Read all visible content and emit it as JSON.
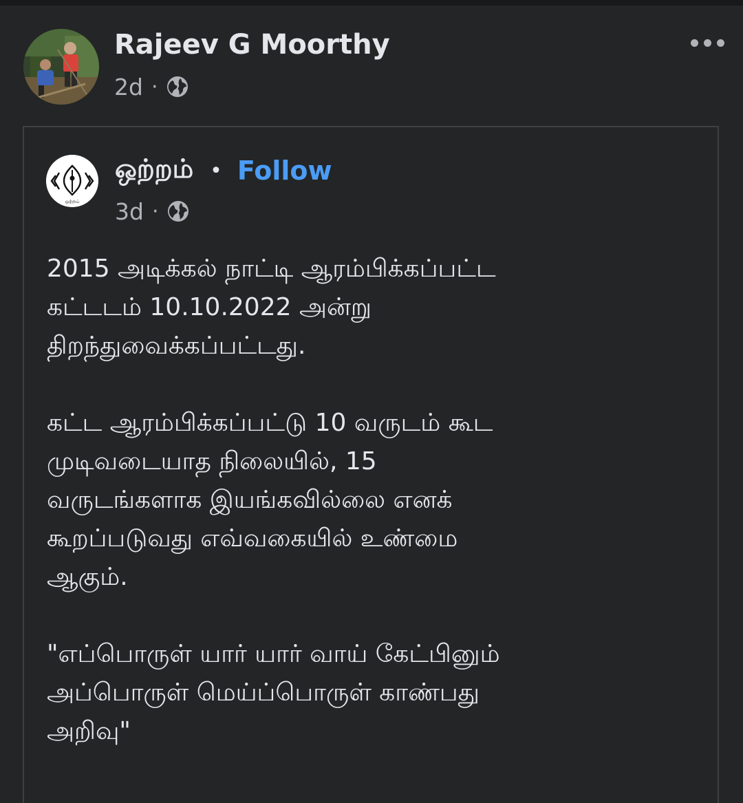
{
  "post": {
    "author": "Rajeev G Moorthy",
    "time": "2d",
    "separator": "·",
    "audience_icon": "globe-icon",
    "more_icon": "more-horizontal-icon"
  },
  "shared_post": {
    "page_name": "ஒற்றம்",
    "separator": "•",
    "follow_label": "Follow",
    "time": "3d",
    "meta_separator": "·",
    "audience_icon": "globe-icon",
    "logo_text": "ஒற்றம்",
    "body": [
      [
        "2015 அடிக்கல் நாட்டி ஆரம்பிக்கப்பட்ட",
        "கட்டடம்  10.10.2022 அன்று",
        "திறந்துவைக்கப்பட்டது."
      ],
      [
        "கட்ட ஆரம்பிக்கப்பட்டு 10 வருடம் கூட",
        "முடிவடையாத நிலையில், 15",
        "வருடங்களாக இயங்கவில்லை எனக்",
        "கூறப்படுவது எவ்வகையில் உண்மை",
        "ஆகும்."
      ],
      [
        "\"எப்பொருள் யார் யார் வாய் கேட்பினும்",
        "அப்பொருள் மெய்ப்பொருள் காண்பது",
        "அறிவு\""
      ]
    ]
  },
  "colors": {
    "background": "#242526",
    "primary_text": "#e4e6eb",
    "secondary_text": "#b0b3b8",
    "link": "#4b9cf5",
    "card_border": "#3e4042"
  }
}
